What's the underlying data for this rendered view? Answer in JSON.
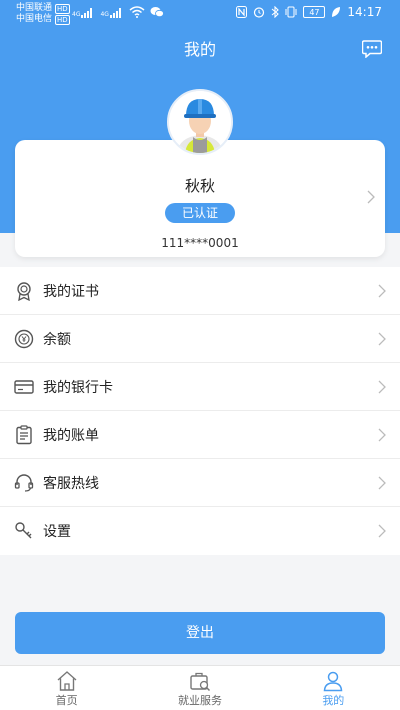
{
  "status_bar": {
    "carrier1": "中国联通",
    "carrier2": "中国电信",
    "hd": "HD",
    "net1": "4G",
    "net2": "4G",
    "battery": "47",
    "time": "14:17"
  },
  "header": {
    "title": "我的"
  },
  "profile": {
    "name": "秋秋",
    "verified_label": "已认证",
    "phone": "111****0001"
  },
  "menu": [
    {
      "label": "我的证书",
      "icon": "certificate-icon"
    },
    {
      "label": "余额",
      "icon": "balance-icon"
    },
    {
      "label": "我的银行卡",
      "icon": "bank-card-icon"
    },
    {
      "label": "我的账单",
      "icon": "bill-icon"
    },
    {
      "label": "客服热线",
      "icon": "headset-icon"
    },
    {
      "label": "设置",
      "icon": "settings-icon"
    }
  ],
  "logout_label": "登出",
  "tabs": [
    {
      "label": "首页",
      "icon": "home-icon"
    },
    {
      "label": "就业服务",
      "icon": "job-service-icon"
    },
    {
      "label": "我的",
      "icon": "profile-icon"
    }
  ],
  "colors": {
    "primary": "#4a9df0",
    "background": "#f4f5f7"
  }
}
